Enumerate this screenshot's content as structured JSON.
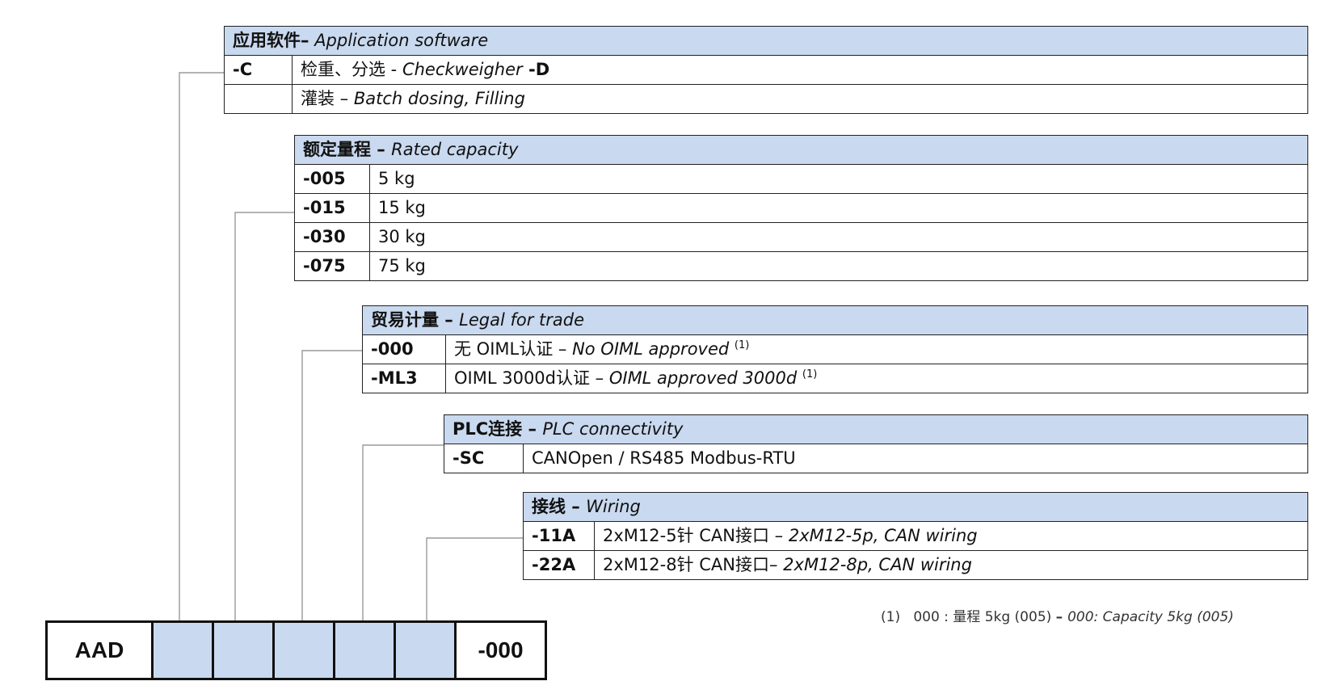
{
  "product_code": {
    "prefix": "AAD",
    "suffix": "-000"
  },
  "sections": {
    "application": {
      "header_cn": "应用软件",
      "header_sep": "–",
      "header_en": "Application software",
      "rows": [
        {
          "code": "-C",
          "desc_cn": "检重、分选 - ",
          "desc_en": "Checkweigher",
          "desc_bold": " -D"
        },
        {
          "code": "",
          "desc_cn": "灌装 – ",
          "desc_en": "Batch dosing, Filling",
          "desc_bold": ""
        }
      ]
    },
    "capacity": {
      "header_cn": "额定量程",
      "header_sep": " – ",
      "header_en": "Rated capacity",
      "rows": [
        {
          "code": "-005",
          "desc": "5 kg"
        },
        {
          "code": "-015",
          "desc": "15 kg"
        },
        {
          "code": "-030",
          "desc": "30 kg"
        },
        {
          "code": "-075",
          "desc": "75 kg"
        }
      ]
    },
    "legal": {
      "header_cn": "贸易计量",
      "header_sep": " – ",
      "header_en": "Legal for trade",
      "rows": [
        {
          "code": "-000",
          "desc_cn": "无 OIML认证 – ",
          "desc_en": "No OIML approved",
          "note": "(1)"
        },
        {
          "code": "-ML3",
          "desc_cn": " OIML 3000d认证 – ",
          "desc_en": "OIML approved 3000d",
          "note": "(1)"
        }
      ]
    },
    "plc": {
      "header_cn": "PLC连接",
      "header_sep": "  – ",
      "header_en": "PLC connectivity",
      "rows": [
        {
          "code": "-SC",
          "desc": "CANOpen / RS485 Modbus-RTU"
        }
      ]
    },
    "wiring": {
      "header_cn": "接线",
      "header_sep": " – ",
      "header_en": "Wiring",
      "rows": [
        {
          "code": "-11A",
          "desc_cn": "2xM12-5针 CAN接口 – ",
          "desc_en": "2xM12-5p, CAN wiring"
        },
        {
          "code": "-22A",
          "desc_cn": "2xM12-8针 CAN接口– ",
          "desc_en": "2xM12-8p, CAN wiring"
        }
      ]
    }
  },
  "footnote": {
    "label": "(1)",
    "text_cn": "000 : 量程 5kg (005) ",
    "sep": "– ",
    "text_en": "000: Capacity 5kg (005)"
  }
}
